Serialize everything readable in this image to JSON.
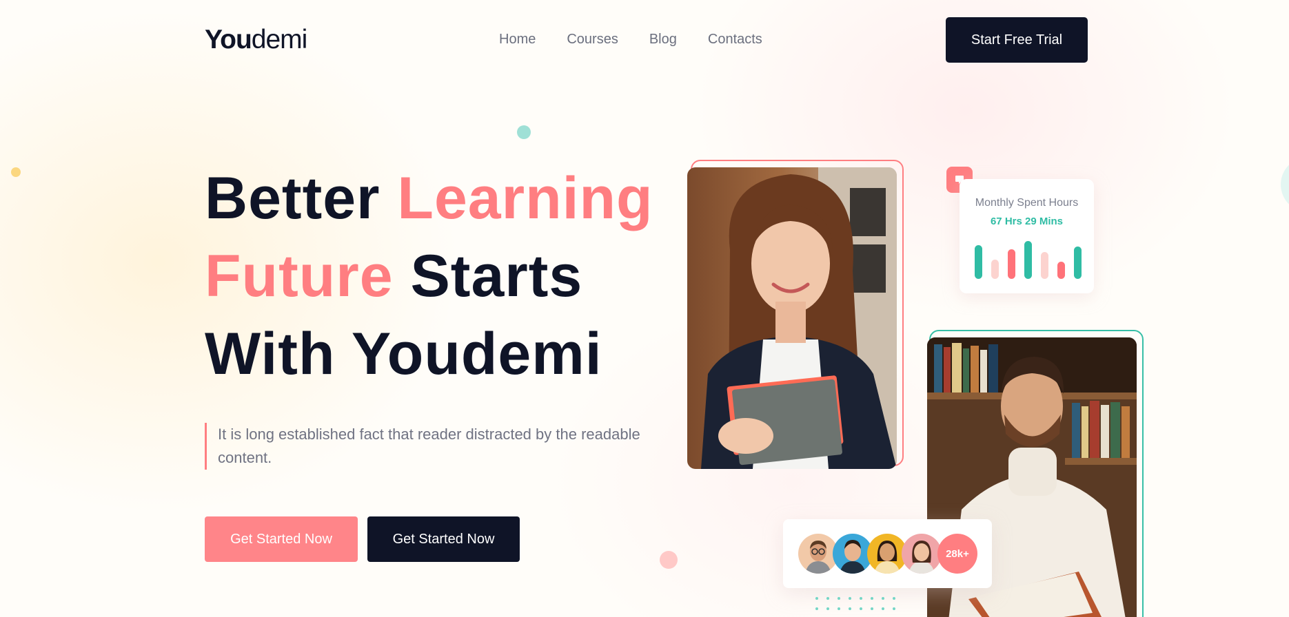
{
  "header": {
    "logo_bold": "You",
    "logo_light": "demi",
    "nav": [
      "Home",
      "Courses",
      "Blog",
      "Contacts"
    ],
    "cta": "Start Free Trial"
  },
  "hero": {
    "line1_a": "Better ",
    "line1_b": "Learning",
    "line2_a": "Future",
    "line2_b": " Starts",
    "line3": "With Youdemi",
    "description": "It is long established fact that reader distracted by the readable content.",
    "primary_button": "Get Started Now",
    "secondary_button": "Get Started Now"
  },
  "stats": {
    "title": "Monthly Spent Hours",
    "value": "67 Hrs 29 Mins",
    "bar_levels": [
      0.82,
      0.46,
      0.72,
      0.92,
      0.65,
      0.42,
      0.78
    ],
    "bar_colors": [
      "#2fbca4",
      "#fcd3cf",
      "#ff7279",
      "#2fbca4",
      "#fcd3cf",
      "#ff7279",
      "#2fbca4"
    ]
  },
  "students": {
    "count": "28k+",
    "avatar_colors": [
      "#f2c9a8",
      "#3aa7d9",
      "#f1b626",
      "#f0a5a8"
    ]
  },
  "colors": {
    "accent": "#ff7e81",
    "dark": "#0f1427",
    "teal": "#2fbca4"
  }
}
